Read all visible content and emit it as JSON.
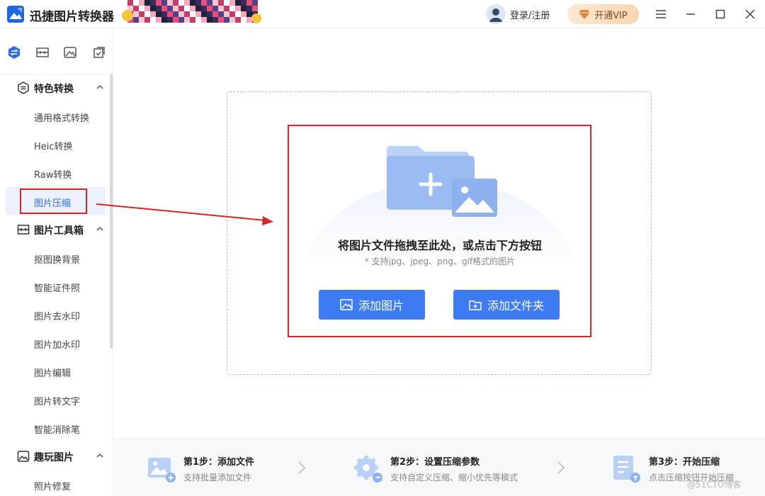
{
  "app": {
    "title": "迅捷图片转换器"
  },
  "header": {
    "login_label": "登录/注册",
    "vip_label": "开通VIP"
  },
  "sidebar": {
    "sections": [
      {
        "label": "特色转换",
        "items": [
          "通用格式转换",
          "Heic转换",
          "Raw转换",
          "图片压缩"
        ]
      },
      {
        "label": "图片工具箱",
        "items": [
          "抠图换背景",
          "智能证件照",
          "图片去水印",
          "图片加水印",
          "图片编辑",
          "图片转文字",
          "智能消除笔"
        ]
      },
      {
        "label": "趣玩图片",
        "items": [
          "照片修复"
        ]
      }
    ],
    "active_item": "图片压缩"
  },
  "main": {
    "drop_title": "将图片文件拖拽至此处，或点击下方按钮",
    "drop_subtitle": "* 支持jpg、jpeg、png、gif格式的图片",
    "add_image_label": "添加图片",
    "add_folder_label": "添加文件夹"
  },
  "steps": [
    {
      "title": "第1步：添加文件",
      "desc": "支持批量添加文件"
    },
    {
      "title": "第2步：设置压缩参数",
      "desc": "支持自定义压缩、缩小优先等模式"
    },
    {
      "title": "第3步：开始压缩",
      "desc": "点击压缩按钮开始压缩"
    }
  ],
  "watermark": "@51CTO博客",
  "colors": {
    "accent": "#3f7cf4",
    "annotation_red": "#d32626",
    "active_bg": "#ebf1fd"
  }
}
